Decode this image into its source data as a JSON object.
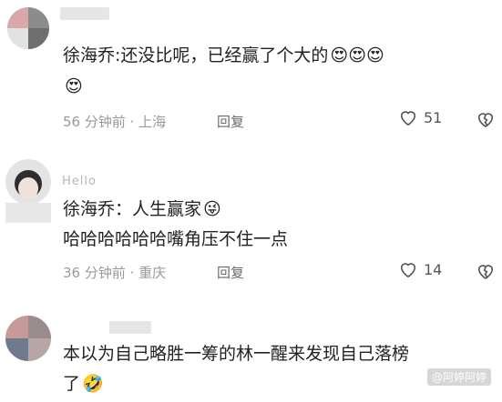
{
  "comments": [
    {
      "handle": "",
      "text_line1": "徐海乔:还没比呢，已经赢了个大的",
      "text_line1_emoji": "😍😍😍",
      "text_line2": "",
      "text_line2_emoji": "😍",
      "time_location": "56 分钟前 · 上海",
      "reply_label": "回复",
      "likes": "51"
    },
    {
      "handle": "Hello",
      "text_line1": "徐海乔：人生赢家",
      "text_line1_emoji": "😜",
      "text_line2": "哈哈哈哈哈哈嘴角压不住一点",
      "text_line2_emoji": "",
      "time_location": "36 分钟前 · 重庆",
      "reply_label": "回复",
      "likes": "14"
    },
    {
      "handle": "",
      "text_line1": "本以为自己略胜一筹的林一醒来发现自己落榜",
      "text_line1_emoji": "",
      "text_line2": "了",
      "text_line2_emoji": "🤣",
      "time_location": "",
      "reply_label": "",
      "likes": ""
    }
  ],
  "watermark": "@阿婷阿婷",
  "icons": {
    "like": "heart-outline-icon",
    "dislike": "broken-heart-icon"
  },
  "colors": {
    "text": "#222222",
    "meta": "#9a9a9a"
  }
}
